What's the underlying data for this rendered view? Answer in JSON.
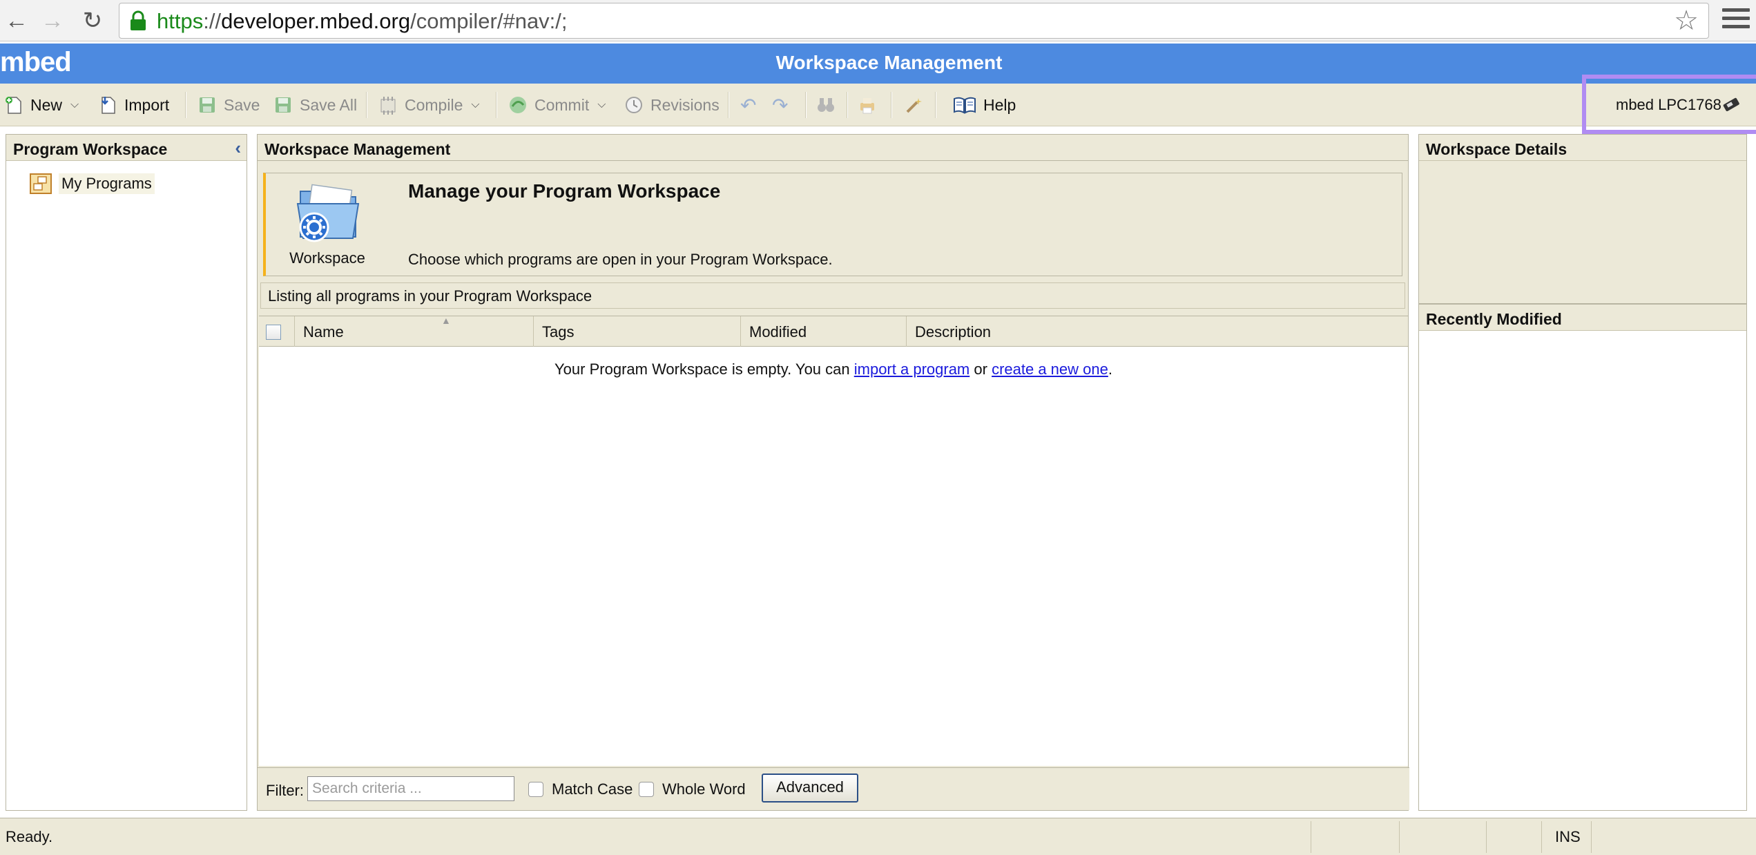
{
  "browser": {
    "url_scheme": "https",
    "url_sep": "://",
    "url_host": "developer.mbed.org",
    "url_path": "/compiler/#nav:/;"
  },
  "header": {
    "logo": "mbed",
    "title": "Workspace Management"
  },
  "toolbar": {
    "new": "New",
    "import": "Import",
    "save": "Save",
    "save_all": "Save All",
    "compile": "Compile",
    "commit": "Commit",
    "revisions": "Revisions",
    "help": "Help",
    "target": "mbed LPC1768"
  },
  "left_panel": {
    "title": "Program Workspace",
    "tree_item": "My Programs"
  },
  "center": {
    "title": "Workspace Management",
    "banner_title": "Manage your Program Workspace",
    "banner_desc": "Choose which programs are open in your Program Workspace.",
    "icon_caption": "Workspace",
    "listing": "Listing all programs in your Program Workspace",
    "columns": [
      "Name",
      "Tags",
      "Modified",
      "Description"
    ],
    "empty_prefix": "Your Program Workspace is empty. You can ",
    "import_link": "import a program",
    "empty_mid": " or ",
    "create_link": "create a new one",
    "empty_suffix": "."
  },
  "filter": {
    "label": "Filter:",
    "placeholder": "Search criteria ...",
    "match_case": "Match Case",
    "whole_word": "Whole Word",
    "advanced": "Advanced"
  },
  "right_panel": {
    "details_title": "Workspace Details",
    "recent_title": "Recently Modified"
  },
  "status": {
    "text": "Ready.",
    "ins": "INS"
  },
  "colors": {
    "header_blue": "#4d8ae0",
    "toolbar_beige": "#ece9d8",
    "highlight_purple": "#b08cf2",
    "link_blue": "#1a1adc"
  }
}
